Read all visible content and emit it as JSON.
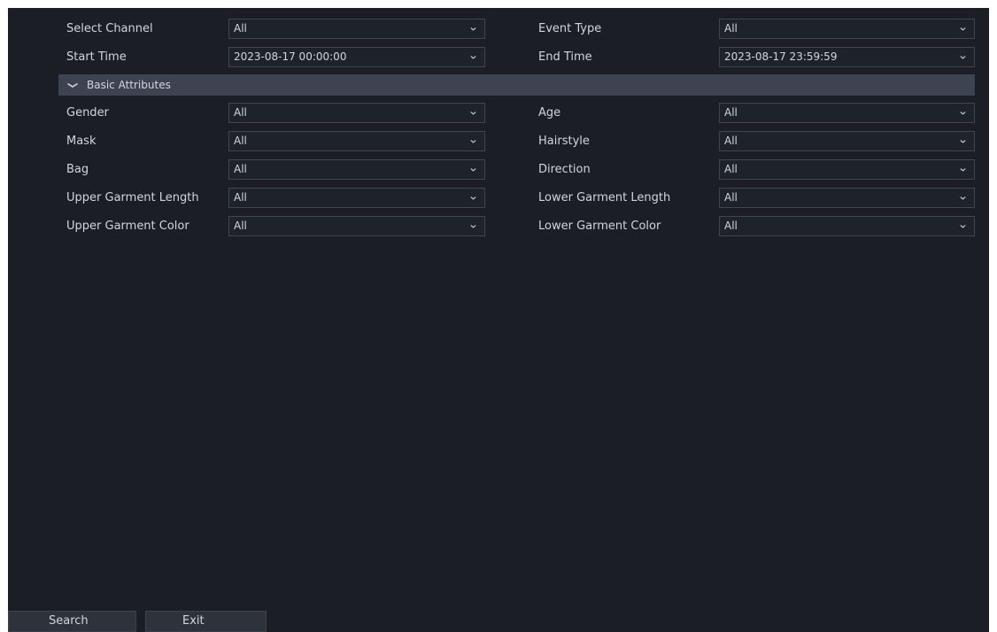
{
  "filters": [
    {
      "left_label": "Select Channel",
      "left_value": "All",
      "right_label": "Event Type",
      "right_value": "All"
    },
    {
      "left_label": "Start Time",
      "left_value": "2023-08-17 00:00:00",
      "right_label": "End Time",
      "right_value": "2023-08-17 23:59:59"
    }
  ],
  "section": {
    "title": "Basic Attributes",
    "icon": "chevron-down-icon"
  },
  "attributes": [
    {
      "left_label": "Gender",
      "left_value": "All",
      "right_label": "Age",
      "right_value": "All"
    },
    {
      "left_label": "Mask",
      "left_value": "All",
      "right_label": "Hairstyle",
      "right_value": "All"
    },
    {
      "left_label": "Bag",
      "left_value": "All",
      "right_label": "Direction",
      "right_value": "All"
    },
    {
      "left_label": "Upper Garment Length",
      "left_value": "All",
      "right_label": "Lower Garment Length",
      "right_value": "All"
    },
    {
      "left_label": "Upper Garment Color",
      "left_value": "All",
      "right_label": "Lower Garment Color",
      "right_value": "All"
    }
  ],
  "buttons": {
    "search": "Search",
    "exit": "Exit"
  },
  "colors": {
    "background": "#1b1f25",
    "section_bar": "#3d4350",
    "text": "#d2d6dc",
    "field_border": "#3f4650"
  }
}
